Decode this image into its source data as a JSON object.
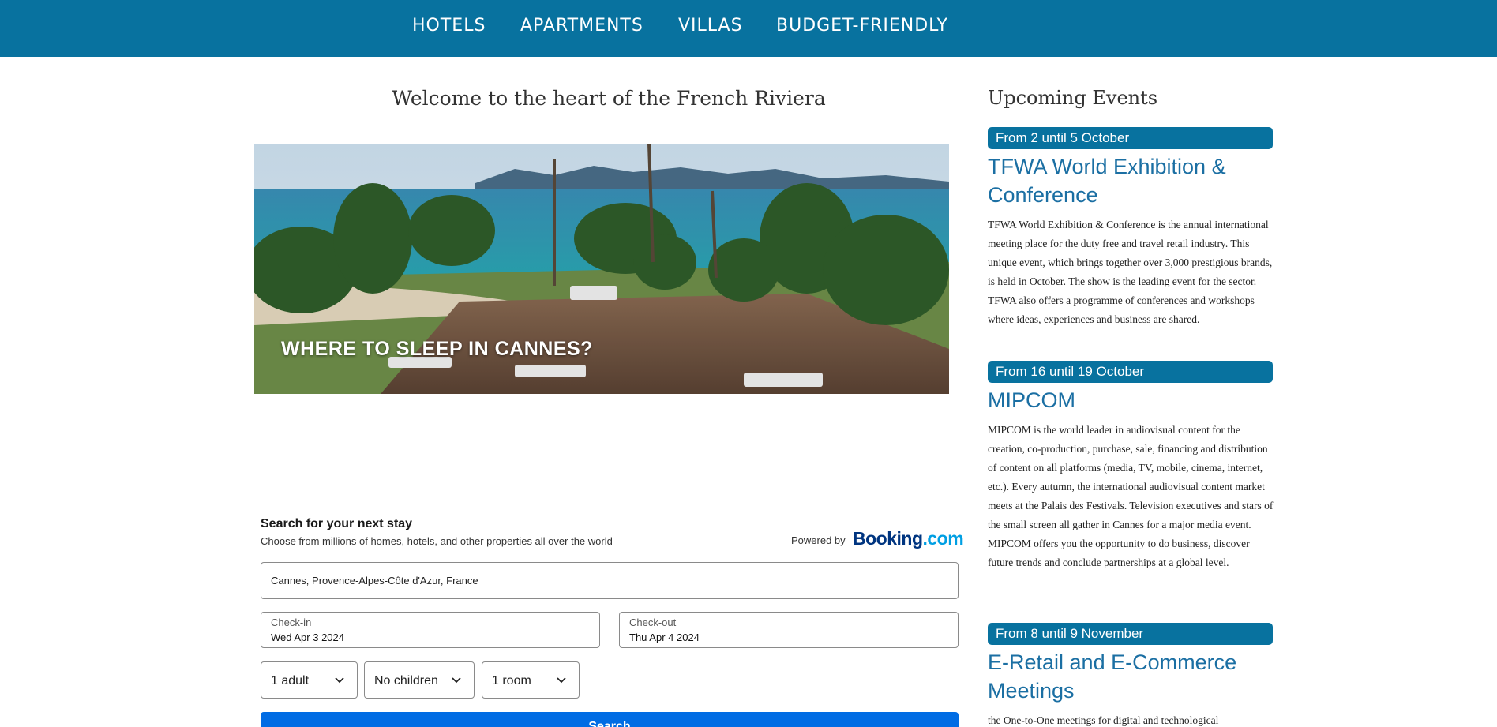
{
  "nav": {
    "items": [
      "HOTELS",
      "APARTMENTS",
      "VILLAS",
      "BUDGET-FRIENDLY"
    ]
  },
  "main": {
    "welcome": "Welcome to the heart of the French Riviera",
    "hero_caption": "WHERE TO SLEEP IN CANNES?"
  },
  "booking": {
    "title": "Search for your next stay",
    "subtitle": "Choose from millions of homes, hotels, and other properties all over the world",
    "powered_by": "Powered by",
    "brand_main": "Booking",
    "brand_suffix": ".com",
    "destination": "Cannes, Provence-Alpes-Côte d'Azur, France",
    "checkin_label": "Check-in",
    "checkin_value": "Wed Apr 3 2024",
    "checkout_label": "Check-out",
    "checkout_value": "Thu Apr 4 2024",
    "adults": "1 adult",
    "children": "No children",
    "rooms": "1 room",
    "search_label": "Search",
    "colors": {
      "button": "#006ce4",
      "brand": "#003580"
    }
  },
  "events": {
    "title": "Upcoming Events",
    "items": [
      {
        "date": "From 2 until 5 October",
        "name": "TFWA World Exhibition & Conference",
        "description": "TFWA World Exhibition & Conference is the annual international meeting place for the duty free and travel retail industry. This unique event, which brings together over 3,000 prestigious brands, is held in October. The show is the leading event for the sector. TFWA also offers a programme of conferences and workshops where ideas, experiences and business are shared."
      },
      {
        "date": "From 16 until 19 October",
        "name": "MIPCOM",
        "description": "MIPCOM is the world leader in audiovisual content for the creation, co-production, purchase, sale, financing and distribution of content on all platforms (media, TV, mobile, cinema, internet, etc.). Every autumn, the international audiovisual content market meets at the Palais des Festivals. Television executives and stars of the small screen all gather in Cannes for a major media event. MIPCOM offers you the opportunity to do business, discover future trends and conclude partnerships at a global level."
      },
      {
        "date": "From 8 until 9 November",
        "name": "E-Retail and E-Commerce Meetings",
        "description": "the One-to-One meetings for digital and technological"
      }
    ]
  },
  "theme": {
    "primary": "#08729f",
    "link": "#1b6fa3"
  }
}
